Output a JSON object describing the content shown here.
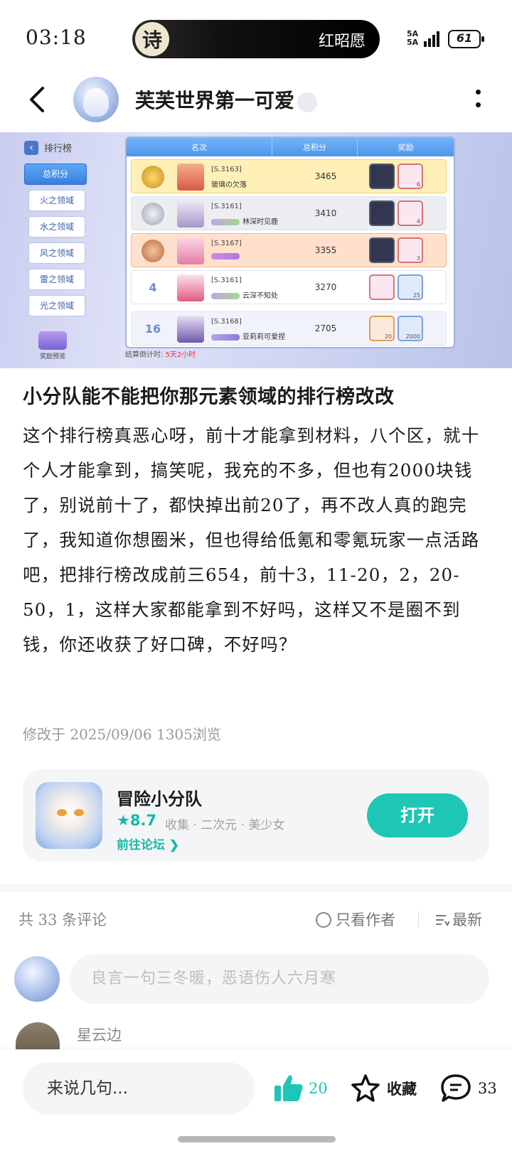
{
  "status": {
    "time": "03:18",
    "island_badge": "诗",
    "island_text": "红昭愿",
    "net": "5A\n5A",
    "battery": "61"
  },
  "header": {
    "author": "芙芙世界第一可爱"
  },
  "game_screenshot": {
    "title": "排行榜",
    "tabs": [
      "总积分",
      "火之领域",
      "水之领域",
      "风之领域",
      "雷之领域",
      "光之领域"
    ],
    "columns": [
      "名次",
      "总积分",
      "奖励"
    ],
    "reward_preview": "奖励预览",
    "rows": [
      {
        "rank": "",
        "server": "[S.3163]",
        "name": "玻璃の欠落",
        "score": "3465",
        "items": [
          "",
          "6"
        ]
      },
      {
        "rank": "",
        "server": "[S.3161]",
        "name": "林深时见鹿",
        "score": "3410",
        "items": [
          "",
          "4"
        ]
      },
      {
        "rank": "",
        "server": "[S.3167]",
        "name": "",
        "score": "3355",
        "items": [
          "",
          "3"
        ]
      },
      {
        "rank": "4",
        "server": "[S.3161]",
        "name": "云深不知处",
        "score": "3270",
        "items": [
          "",
          "25"
        ]
      },
      {
        "rank": "16",
        "server": "[S.3168]",
        "name": "亚莉莉可爱捏",
        "score": "2705",
        "items": [
          "20",
          "2000"
        ]
      }
    ],
    "countdown_label": "结算倒计时:",
    "countdown_value": "5天2小时"
  },
  "post": {
    "title": "小分队能不能把你那元素领域的排行榜改改",
    "body": "这个排行榜真恶心呀，前十才能拿到材料，八个区，就十个人才能拿到，搞笑呢，我充的不多，但也有2000块钱了，别说前十了，都快掉出前20了，再不改人真的跑完了，我知道你想圈米，但也得给低氪和零氪玩家一点活路吧，把排行榜改成前三654，前十3，11-20，2，20-50，1，这样大家都能拿到不好吗，这样又不是圈不到钱，你还收获了好口碑，不好吗？",
    "meta": "修改于 2025/09/06  1305浏览"
  },
  "game_card": {
    "name": "冒险小分队",
    "rating": "★8.7",
    "tags": "收集 · 二次元 · 美少女",
    "forum_link": "前往论坛 ❯",
    "open_label": "打开"
  },
  "comments": {
    "count_label": "共 33 条评论",
    "author_only": "只看作者",
    "sort": "最新",
    "input_placeholder": "良言一句三冬暖，恶语伤人六月寒",
    "first_commenter": "星云边"
  },
  "bottom_bar": {
    "input_placeholder": "来说几句...",
    "likes": "20",
    "favorite_label": "收藏",
    "comment_count": "33"
  },
  "colors": {
    "accent": "#1ec6b5",
    "text": "#1a1a1a",
    "muted": "#9a9a9a"
  }
}
